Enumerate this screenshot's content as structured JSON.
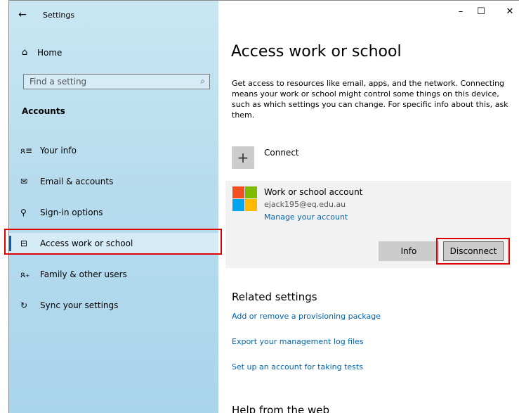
{
  "window": {
    "title": "Settings"
  },
  "titlebar": {
    "back_icon": "back-arrow-icon",
    "minimize": "–",
    "maximize": "☐",
    "close": "✕"
  },
  "sidebar": {
    "home_label": "Home",
    "search": {
      "placeholder": "Find a setting"
    },
    "section_title": "Accounts",
    "items": [
      {
        "label": "Your info",
        "icon": "person-info-icon"
      },
      {
        "label": "Email & accounts",
        "icon": "mail-icon"
      },
      {
        "label": "Sign-in options",
        "icon": "key-icon"
      },
      {
        "label": "Access work or school",
        "icon": "briefcase-icon",
        "selected": true
      },
      {
        "label": "Family & other users",
        "icon": "person-add-icon"
      },
      {
        "label": "Sync your settings",
        "icon": "sync-icon"
      }
    ]
  },
  "main": {
    "title": "Access work or school",
    "description": "Get access to resources like email, apps, and the network. Connecting means your work or school might control some things on this device, such as which settings you can change. For specific info about this, ask them.",
    "connect_label": "Connect",
    "account": {
      "title": "Work or school account",
      "email": "ejack195@eq.edu.au",
      "manage_link": "Manage your account",
      "info_button": "Info",
      "disconnect_button": "Disconnect"
    },
    "related": {
      "title": "Related settings",
      "links": [
        "Add or remove a provisioning package",
        "Export your management log files",
        "Set up an account for taking tests"
      ]
    },
    "help_title": "Help from the web"
  },
  "colors": {
    "accent": "#0063b1",
    "highlight_box": "#e00000",
    "sidebar_bg": "#b7dcee"
  }
}
